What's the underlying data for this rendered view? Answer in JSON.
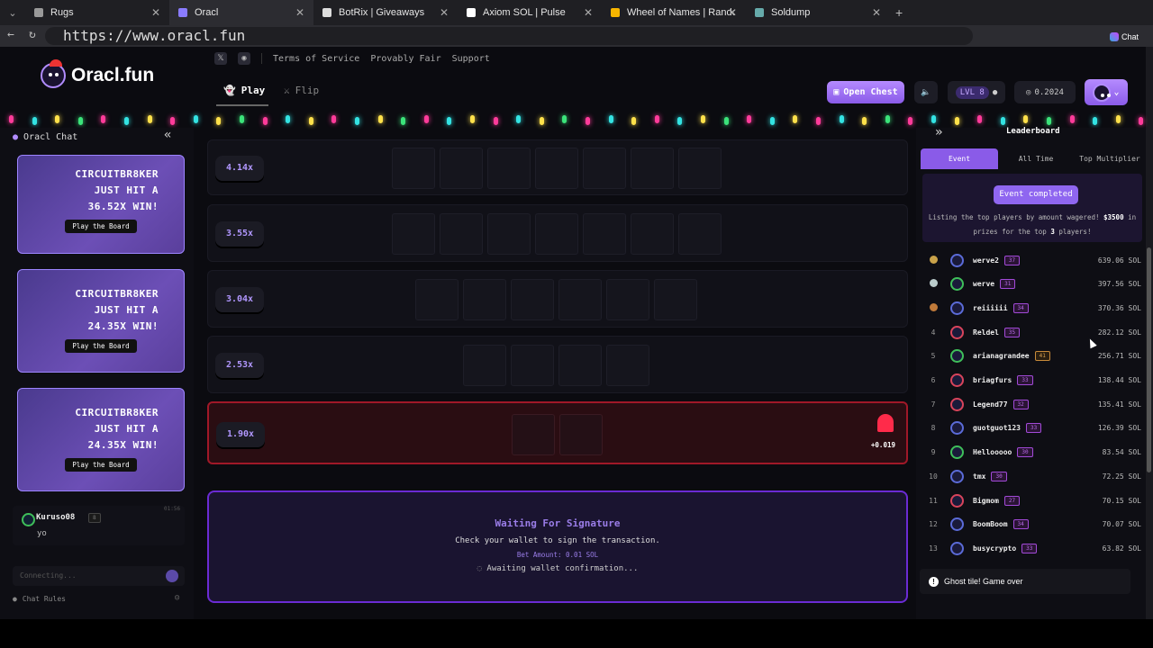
{
  "browser": {
    "tabs": [
      {
        "title": "Rugs",
        "active": false
      },
      {
        "title": "Oracl",
        "active": true
      },
      {
        "title": "BotRix | Giveaways",
        "active": false
      },
      {
        "title": "Axiom SOL | Pulse",
        "active": false
      },
      {
        "title": "Wheel of Names | Random name",
        "active": false
      },
      {
        "title": "Soldump",
        "active": false
      }
    ],
    "url": "https://www.oracl.fun",
    "chat_label": "Chat"
  },
  "site": {
    "logo_text": "Oracl.fun",
    "nav_links": [
      "Terms of Service",
      "Provably Fair",
      "Support"
    ],
    "modes": [
      "Play",
      "Flip"
    ],
    "open_chest": "Open Chest",
    "level": "LVL 8",
    "balance": "0.2024"
  },
  "chat": {
    "title": "Oracl Chat",
    "cards": [
      {
        "lines": [
          "CIRCUITBR8KER",
          "JUST HIT A",
          "36.52X WIN!"
        ],
        "button": "Play the Board"
      },
      {
        "lines": [
          "CIRCUITBR8KER",
          "JUST HIT A",
          "24.35X WIN!"
        ],
        "button": "Play the Board"
      },
      {
        "lines": [
          "CIRCUITBR8KER",
          "JUST HIT A",
          "24.35X WIN!"
        ],
        "button": "Play the Board"
      }
    ],
    "message": {
      "user": "Kuruso08",
      "level": "8",
      "time": "01:56",
      "text": "yo"
    },
    "input_placeholder": "Connecting...",
    "rules": "Chat Rules"
  },
  "board": {
    "rows": [
      {
        "mult": "4.14x",
        "tiles": 7
      },
      {
        "mult": "3.55x",
        "tiles": 7
      },
      {
        "mult": "3.04x",
        "tiles": 6
      },
      {
        "mult": "2.53x",
        "tiles": 4
      },
      {
        "mult": "1.90x",
        "tiles": 2,
        "lost": true,
        "result": "+0.019"
      }
    ],
    "wait_title": "Waiting For Signature",
    "wait_text": "Check your wallet to sign the transaction.",
    "bet_amount": "Bet Amount: 0.01 SOL",
    "awaiting": "Awaiting wallet confirmation..."
  },
  "leaderboard": {
    "title": "Leaderboard",
    "tabs": [
      "Event",
      "All Time",
      "Top Multiplier"
    ],
    "status": "Event completed",
    "desc_a": "Listing the top players by amount wagered! ",
    "desc_prize": "$3500",
    "desc_b": " in prizes for the top ",
    "desc_top": "3",
    "desc_c": " players!",
    "rows": [
      {
        "rank": "",
        "name": "werve2",
        "level": "37",
        "amount": "639.06 SOL"
      },
      {
        "rank": "",
        "name": "werve",
        "level": "31",
        "amount": "397.56 SOL"
      },
      {
        "rank": "",
        "name": "reiiiiii",
        "level": "34",
        "amount": "370.36 SOL"
      },
      {
        "rank": "4",
        "name": "Reldel",
        "level": "35",
        "amount": "282.12 SOL"
      },
      {
        "rank": "5",
        "name": "arianagrandee",
        "level": "41",
        "amount": "256.71 SOL"
      },
      {
        "rank": "6",
        "name": "briagfurs",
        "level": "33",
        "amount": "138.44 SOL"
      },
      {
        "rank": "7",
        "name": "Legend77",
        "level": "32",
        "amount": "135.41 SOL"
      },
      {
        "rank": "8",
        "name": "guotguot123",
        "level": "33",
        "amount": "126.39 SOL"
      },
      {
        "rank": "9",
        "name": "Hellooooo",
        "level": "30",
        "amount": "83.54 SOL"
      },
      {
        "rank": "10",
        "name": "tmx",
        "level": "30",
        "amount": "72.25 SOL"
      },
      {
        "rank": "11",
        "name": "Bigmom",
        "level": "27",
        "amount": "70.15 SOL"
      },
      {
        "rank": "12",
        "name": "BoomBoom",
        "level": "34",
        "amount": "70.07 SOL"
      },
      {
        "rank": "13",
        "name": "busycrypto",
        "level": "33",
        "amount": "63.82 SOL"
      }
    ]
  },
  "toast": "Ghost tile! Game over"
}
